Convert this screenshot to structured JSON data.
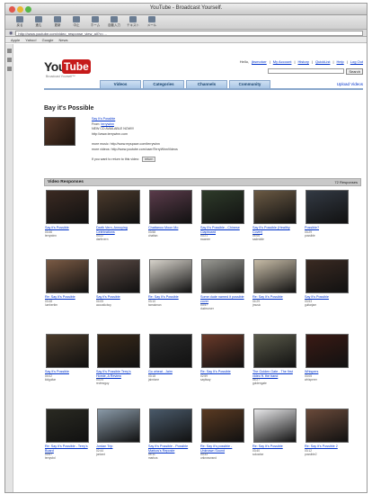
{
  "window": {
    "title": "YouTube - Broadcast Yourself."
  },
  "toolbar": {
    "items": [
      "戻る",
      "進む",
      "更新",
      "中止",
      "ホーム",
      "自動入力",
      "テキスト",
      "メール"
    ]
  },
  "address": {
    "value": "http://www.youtube.com/video_response_view_all?v=…"
  },
  "bookmarks": {
    "items": [
      "Apple",
      "Yahoo!",
      "Google",
      "News"
    ]
  },
  "site": {
    "logo_you": "You",
    "logo_tube": "Tube",
    "tagline": "Broadcast Yourself™",
    "hello": "Hello,",
    "username": "jbsmotorr",
    "links": [
      "My Account",
      "History",
      "QuickList",
      "Help",
      "Log Out"
    ],
    "search_button": "Search",
    "nav": [
      "Videos",
      "Categories",
      "Channels",
      "Community"
    ],
    "upload": "Upload Videos"
  },
  "video": {
    "title": "Bay it's Possible",
    "link_title": "Say It's Possible",
    "from_label": "From:",
    "from_user": "terrywinn",
    "line3": "NEW CD AVAILABLE NOW!!!",
    "line4": "http://www.terrywinn.com",
    "more1": "more music: http://www.myspace.com/terrywinn",
    "more2": "more videos: http://www.youtube.com/user/TerryWinnVideos",
    "back_prompt": "If you want to return to this video:",
    "back_button": "return"
  },
  "responses": {
    "header": "Video Responses",
    "count": "72 Responses",
    "items": [
      {
        "title": "Say it's Possible",
        "dur": "03:46",
        "from": "terrywinn"
      },
      {
        "title": "Darth Vern, Annoying Celebrations",
        "dur": "03:22",
        "from": "darthvern"
      },
      {
        "title": "Chattanoo Moon Mo",
        "dur": "03:58",
        "from": "chattan"
      },
      {
        "title": "Say It's Possible - Chinese Clapboard",
        "dur": "03:21",
        "from": "swanee"
      },
      {
        "title": "Say It's Possible (Healthy Cover)",
        "dur": "04:06",
        "from": "sadeddie"
      },
      {
        "title": "Possible?",
        "dur": "03:29",
        "from": "possible"
      },
      {
        "title": "Re: Say It's Possible",
        "dur": "03:48",
        "from": "lumbertim"
      },
      {
        "title": "Say it's Possible",
        "dur": "04:05",
        "from": "acousticboy"
      },
      {
        "title": "Re: Say It's Possible",
        "dur": "03:10",
        "from": "tweakman"
      },
      {
        "title": "Some dude named it possible cover",
        "dur": "03:47",
        "from": "dudecover"
      },
      {
        "title": "Re: Say It's Possible",
        "dur": "04:29",
        "from": "jmusic"
      },
      {
        "title": "Say It's Possible",
        "dur": "03:53",
        "from": "guitarjam"
      },
      {
        "title": "Say It's Possible",
        "dur": "04:02",
        "from": "kidguitar"
      },
      {
        "title": "Say It's Possible Terry's Homie, A Review",
        "dur": "03:24",
        "from": "reviewguy"
      },
      {
        "title": "Go wheat - Jaim",
        "dur": "03:18",
        "from": "jaimtone"
      },
      {
        "title": "Re: Say It's Possible",
        "dur": "02:59",
        "from": "sayitsay"
      },
      {
        "title": "The Golden Gate - The first video ft. the band",
        "dur": "04:27",
        "from": "goldengate"
      },
      {
        "title": "Whispers",
        "dur": "03:05",
        "from": "whisperer"
      },
      {
        "title": "Re: Say It's Possible - Terry's Board",
        "dur": "03:57",
        "from": "terrysbd"
      },
      {
        "title": "Jordan Trip",
        "dur": "02:44",
        "from": "jordant"
      },
      {
        "title": "Say It's Possible - Possible Markos's Reposte",
        "dur": "04:11",
        "from": "markos"
      },
      {
        "title": "Re: Say it's possible - Unknown Sound",
        "dur": "03:33",
        "from": "unknownsnd"
      },
      {
        "title": "Re: Say It's Possible",
        "dur": "03:40",
        "from": "solowise"
      },
      {
        "title": "Re: Say It's Possible 2",
        "dur": "03:12",
        "from": "possible2"
      }
    ]
  },
  "thumb_colors": [
    "#3b2a22",
    "#4b3a2c",
    "#5a3b4a",
    "#2e3b2a",
    "#6b5a44",
    "#333a44",
    "#7a5a44",
    "#5a4a44",
    "#d8d4cc",
    "#9a9a94",
    "#c8bda8",
    "#3a2a22",
    "#4a3a2a",
    "#3a2a1a",
    "#2a2a2a",
    "#6a3a2a",
    "#5a5a4a",
    "#3a1a14",
    "#2a2a22",
    "#8a9aa8",
    "#4a5a6a",
    "#5a3a22",
    "#e8e8ea",
    "#6a4a3a"
  ]
}
